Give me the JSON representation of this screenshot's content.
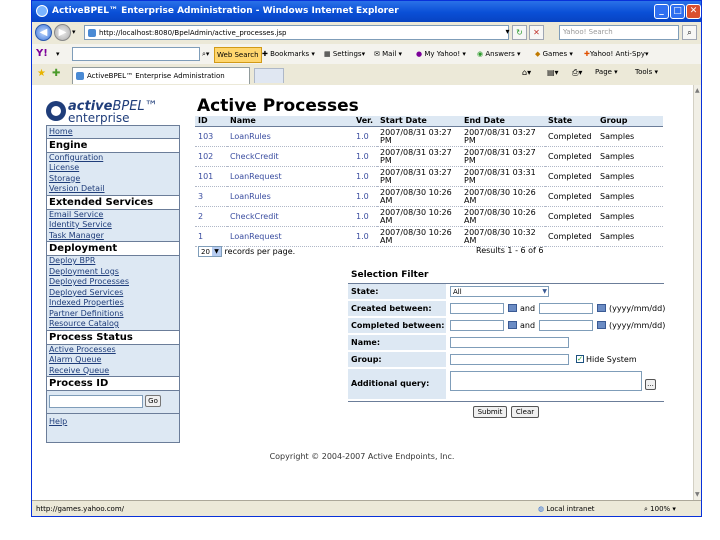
{
  "window": {
    "title": "ActiveBPEL™ Enterprise Administration - Windows Internet Explorer"
  },
  "address": {
    "url": "http://localhost:8080/BpelAdmin/active_processes.jsp",
    "search_placeholder": "Yahoo! Search"
  },
  "yahoo_toolbar": {
    "logo": "Y!",
    "web_search": "Web Search",
    "bookmarks": "Bookmarks",
    "settings": "Settings",
    "mail": "Mail",
    "my_yahoo": "My Yahoo!",
    "answers": "Answers",
    "games": "Games",
    "anti_spy": "Yahoo! Anti-Spy"
  },
  "tab": {
    "title": "ActiveBPEL™ Enterprise Administration",
    "page_menu": "Page",
    "tools_menu": "Tools"
  },
  "logo": {
    "line1_bold": "active",
    "line1_rest": "BPEL™",
    "line2": "enterprise"
  },
  "sidebar": {
    "home": "Home",
    "engine": {
      "title": "Engine",
      "items": [
        "Configuration",
        "License",
        "Storage",
        "Version Detail"
      ]
    },
    "extended": {
      "title": "Extended Services",
      "items": [
        "Email Service",
        "Identity Service",
        "Task Manager"
      ]
    },
    "deployment": {
      "title": "Deployment",
      "items": [
        "Deploy BPR",
        "Deployment Logs",
        "Deployed Processes",
        "Deployed Services",
        "Indexed Properties",
        "Partner Definitions",
        "Resource Catalog"
      ]
    },
    "process_status": {
      "title": "Process Status",
      "items": [
        "Active Processes",
        "Alarm Queue",
        "Receive Queue"
      ]
    },
    "process_id": {
      "title": "Process ID",
      "go": "Go"
    },
    "help": "Help"
  },
  "main": {
    "title": "Active Processes",
    "columns": [
      "ID",
      "Name",
      "Ver.",
      "Start Date",
      "End Date",
      "State",
      "Group"
    ],
    "rows": [
      {
        "id": "103",
        "name": "LoanRules",
        "ver": "1.0",
        "start": "2007/08/31 03:27 PM",
        "end": "2007/08/31 03:27 PM",
        "state": "Completed",
        "group": "Samples"
      },
      {
        "id": "102",
        "name": "CheckCredit",
        "ver": "1.0",
        "start": "2007/08/31 03:27 PM",
        "end": "2007/08/31 03:27 PM",
        "state": "Completed",
        "group": "Samples"
      },
      {
        "id": "101",
        "name": "LoanRequest",
        "ver": "1.0",
        "start": "2007/08/31 03:27 PM",
        "end": "2007/08/31 03:31 PM",
        "state": "Completed",
        "group": "Samples"
      },
      {
        "id": "3",
        "name": "LoanRules",
        "ver": "1.0",
        "start": "2007/08/30 10:26 AM",
        "end": "2007/08/30 10:26 AM",
        "state": "Completed",
        "group": "Samples"
      },
      {
        "id": "2",
        "name": "CheckCredit",
        "ver": "1.0",
        "start": "2007/08/30 10:26 AM",
        "end": "2007/08/30 10:26 AM",
        "state": "Completed",
        "group": "Samples"
      },
      {
        "id": "1",
        "name": "LoanRequest",
        "ver": "1.0",
        "start": "2007/08/30 10:26 AM",
        "end": "2007/08/30 10:32 AM",
        "state": "Completed",
        "group": "Samples"
      }
    ],
    "records_per_page_value": "20",
    "records_per_page_label": "records per page.",
    "results_text": "Results 1 - 6 of 6"
  },
  "filter": {
    "title": "Selection Filter",
    "state_label": "State:",
    "state_value": "All",
    "created_label": "Created between:",
    "completed_label": "Completed between:",
    "and": "and",
    "date_hint": "(yyyy/mm/dd)",
    "name_label": "Name:",
    "group_label": "Group:",
    "hide_system": "Hide System",
    "additional_label": "Additional query:",
    "more_button": "...",
    "submit": "Submit",
    "clear": "Clear"
  },
  "footer": {
    "copyright": "Copyright © 2004-2007 Active Endpoints, Inc."
  },
  "status": {
    "url": "http://games.yahoo.com/",
    "zone": "Local intranet",
    "zoom": "100%"
  }
}
